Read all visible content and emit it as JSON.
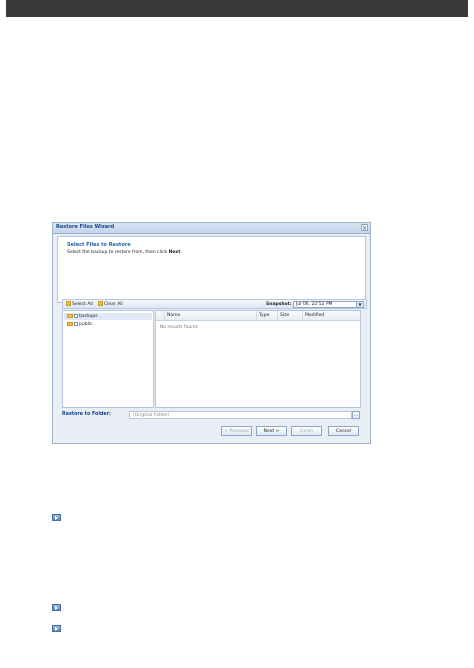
{
  "wizard": {
    "title": "Restore Files Wizard",
    "close_glyph": "×",
    "header": {
      "title": "Select Files to Restore",
      "subtitle_prefix": "Select the backup to restore from, then click ",
      "subtitle_bold": "Next",
      "subtitle_suffix": "."
    },
    "toolbar": {
      "select_all": "Select All",
      "clear_all": "Clear All",
      "snapshot_label": "Snapshot:",
      "snapshot_value": "Jul 06, 22:52 PM"
    },
    "tree": [
      {
        "label": "backups"
      },
      {
        "label": "public"
      }
    ],
    "grid": {
      "columns": [
        "Name",
        "Type",
        "Size",
        "Modified"
      ],
      "empty_message": "No results found."
    },
    "restore_to": {
      "label": "Restore to Folder:",
      "value": "(Original Folder)",
      "browse_glyph": "..."
    },
    "buttons": {
      "previous": "< Previous",
      "next": "Next >",
      "finish": "Finish",
      "cancel": "Cancel"
    }
  },
  "icons": {
    "select_all": "folder-check-icon",
    "clear_all": "folder-clear-icon",
    "tree_folder": "folder-icon",
    "bullet": "arrow-bullet-icon"
  }
}
